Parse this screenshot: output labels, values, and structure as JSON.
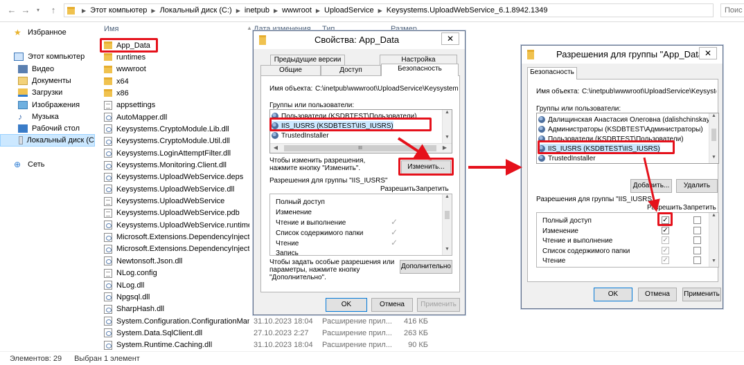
{
  "explorer": {
    "breadcrumb": [
      "Этот компьютер",
      "Локальный диск (C:)",
      "inetpub",
      "wwwroot",
      "UploadService",
      "Keysystems.UploadWebService_6.1.8942.1349"
    ],
    "search_placeholder": "Поис",
    "nav": {
      "favorites": "Избранное",
      "this_pc": "Этот компьютер",
      "video": "Видео",
      "documents": "Документы",
      "downloads": "Загрузки",
      "images": "Изображения",
      "music": "Музыка",
      "desktop": "Рабочий стол",
      "local_disk": "Локальный диск (C",
      "network": "Сеть"
    },
    "columns": {
      "name": "Имя",
      "date": "Дата изменения",
      "type": "Тип",
      "size": "Размер"
    },
    "files": [
      {
        "name": "App_Data",
        "icon": "folder-icon"
      },
      {
        "name": "runtimes",
        "icon": "folder-icon"
      },
      {
        "name": "wwwroot",
        "icon": "folder-icon"
      },
      {
        "name": "x64",
        "icon": "folder-icon"
      },
      {
        "name": "x86",
        "icon": "folder-icon"
      },
      {
        "name": "appsettings",
        "icon": "settings-file-icon"
      },
      {
        "name": "AutoMapper.dll",
        "icon": "dll-icon"
      },
      {
        "name": "Keysystems.CryptoModule.Lib.dll",
        "icon": "dll-icon"
      },
      {
        "name": "Keysystems.CryptoModule.Util.dll",
        "icon": "dll-icon"
      },
      {
        "name": "Keysystems.LoginAttemptFilter.dll",
        "icon": "dll-icon"
      },
      {
        "name": "Keysystems.Monitoring.Client.dll",
        "icon": "dll-icon"
      },
      {
        "name": "Keysystems.UploadWebService.deps",
        "icon": "dll-icon"
      },
      {
        "name": "Keysystems.UploadWebService.dll",
        "icon": "dll-icon"
      },
      {
        "name": "Keysystems.UploadWebService",
        "icon": "exe-icon"
      },
      {
        "name": "Keysystems.UploadWebService.pdb",
        "icon": "file-icon"
      },
      {
        "name": "Keysystems.UploadWebService.runtimec...",
        "icon": "dll-icon"
      },
      {
        "name": "Microsoft.Extensions.DependencyInjectio...",
        "icon": "dll-icon"
      },
      {
        "name": "Microsoft.Extensions.DependencyInjectio...",
        "icon": "dll-icon"
      },
      {
        "name": "Newtonsoft.Json.dll",
        "icon": "dll-icon"
      },
      {
        "name": "NLog.config",
        "icon": "file-icon"
      },
      {
        "name": "NLog.dll",
        "icon": "dll-icon"
      },
      {
        "name": "Npgsql.dll",
        "icon": "dll-icon"
      },
      {
        "name": "SharpHash.dll",
        "icon": "dll-icon"
      },
      {
        "name": "System.Configuration.ConfigurationMan...",
        "icon": "dll-icon",
        "date": "31.10.2023 18:04",
        "type": "Расширение прил...",
        "size": "416 КБ"
      },
      {
        "name": "System.Data.SqlClient.dll",
        "icon": "dll-icon",
        "date": "27.10.2023 2:27",
        "type": "Расширение прил...",
        "size": "263 КБ"
      },
      {
        "name": "System.Runtime.Caching.dll",
        "icon": "dll-icon",
        "date": "31.10.2023 18:04",
        "type": "Расширение прил...",
        "size": "90 КБ"
      }
    ],
    "status": {
      "count": "Элементов: 29",
      "selected": "Выбран 1 элемент"
    }
  },
  "props_dialog": {
    "title": "Свойства: App_Data",
    "close": "✕",
    "tabs_row1": [
      "Предыдущие версии",
      "Настройка"
    ],
    "tabs_row2": [
      "Общие",
      "Доступ",
      "Безопасность"
    ],
    "object_name_label": "Имя объекта:",
    "object_name_value": "C:\\inetpub\\wwwroot\\UploadService\\Keysystems.U",
    "groups_label": "Группы или пользователи:",
    "groups": [
      "Пользователи (KSDBTEST\\Пользователи)",
      "IIS_IUSRS (KSDBTEST\\IIS_IUSRS)",
      "TrustedInstaller"
    ],
    "change_hint": "Чтобы изменить разрешения,\nнажмите кнопку \"Изменить\".",
    "change_button": "Изменить...",
    "perms_for": "Разрешения для группы \"IIS_IUSRS\"",
    "allow": "Разрешить",
    "deny": "Запретить",
    "perms": [
      "Полный доступ",
      "Изменение",
      "Чтение и выполнение",
      "Список содержимого папки",
      "Чтение",
      "Запись"
    ],
    "special_hint": "Чтобы задать особые разрешения или\nпараметры, нажмите кнопку\n\"Дополнительно\".",
    "advanced_button": "Дополнительно",
    "ok": "OK",
    "cancel": "Отмена",
    "apply": "Применить"
  },
  "perm_dialog": {
    "title": "Разрешения для группы \"App_Data\"",
    "close": "✕",
    "tab": "Безопасность",
    "object_name_label": "Имя объекта:",
    "object_name_value": "C:\\inetpub\\wwwroot\\UploadService\\Keysystems.U",
    "groups_label": "Группы или пользователи:",
    "groups": [
      "Далищинская Анастасия Олеговна (dalishchinskaya@k",
      "Администраторы (KSDBTEST\\Администраторы)",
      "Пользователи (KSDBTEST\\Пользователи)",
      "IIS_IUSRS (KSDBTEST\\IIS_IUSRS)",
      "TrustedInstaller"
    ],
    "add_button": "Добавить...",
    "remove_button": "Удалить",
    "perms_for": "Разрешения для группы \"IIS_IUSRS\"",
    "allow": "Разрешить",
    "deny": "Запретить",
    "perms": [
      "Полный доступ",
      "Изменение",
      "Чтение и выполнение",
      "Список содержимого папки",
      "Чтение"
    ],
    "check_mark": "✓",
    "ok": "OK",
    "cancel": "Отмена",
    "apply": "Применить"
  },
  "colors": {
    "highlight": "#e5111b",
    "selection": "#cce8ff",
    "title_bg": "#ffffff"
  }
}
